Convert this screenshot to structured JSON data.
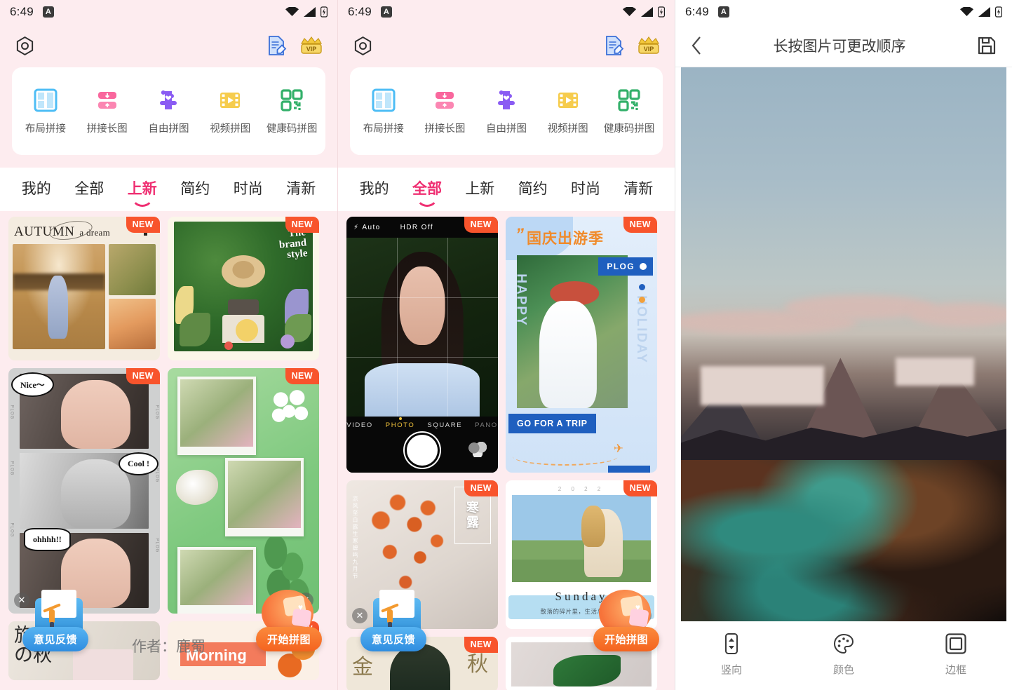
{
  "status_bar": {
    "time": "6:49",
    "app_badge": "A",
    "icons": [
      "wifi-icon",
      "signal-icon",
      "battery-icon"
    ]
  },
  "panel_left": {
    "header": {
      "settings_icon": "settings-hexagon-icon",
      "edit_icon": "document-edit-icon",
      "vip_icon": "vip-crown-icon",
      "vip_label": "VIP"
    },
    "functions": [
      {
        "label": "布局拼接",
        "icon": "layout-collage-icon"
      },
      {
        "label": "拼接长图",
        "icon": "long-image-stitch-icon"
      },
      {
        "label": "自由拼图",
        "icon": "free-collage-icon"
      },
      {
        "label": "视频拼图",
        "icon": "video-collage-icon"
      },
      {
        "label": "健康码拼图",
        "icon": "health-code-collage-icon"
      }
    ],
    "tabs": [
      {
        "label": "我的",
        "active": false
      },
      {
        "label": "全部",
        "active": false
      },
      {
        "label": "上新",
        "active": true
      },
      {
        "label": "简约",
        "active": false
      },
      {
        "label": "时尚",
        "active": false
      },
      {
        "label": "清新",
        "active": false
      }
    ],
    "badge_new": "NEW",
    "cards": {
      "autumn": {
        "title": "AUTUMN",
        "subtitle": "a dream"
      },
      "brand": {
        "line1": "The",
        "line2": "brand",
        "line3": "style"
      },
      "comic": {
        "bubble1": "Nice～",
        "bubble2": "Cool !",
        "bubble3": "ohhhh!!",
        "side_mark": "PLOG"
      },
      "travel": {
        "line1": "旅行",
        "line2": "の秋"
      },
      "morning": {
        "title": "Morning"
      }
    },
    "watermark": "作者：鹿蜀",
    "fab_feedback": "意见反馈",
    "fab_start": "开始拼图"
  },
  "panel_mid": {
    "tabs": [
      {
        "label": "我的",
        "active": false
      },
      {
        "label": "全部",
        "active": true
      },
      {
        "label": "上新",
        "active": false
      },
      {
        "label": "简约",
        "active": false
      },
      {
        "label": "时尚",
        "active": false
      },
      {
        "label": "清新",
        "active": false
      }
    ],
    "cards": {
      "camera": {
        "flash": "Auto",
        "hdr": "HDR Off",
        "modes": [
          "VIDEO",
          "PHOTO",
          "SQUARE",
          "PANO"
        ],
        "active_mode": "PHOTO"
      },
      "trip": {
        "title": "国庆出游季",
        "chip": "PLOG",
        "cta": "GO FOR A TRIP",
        "side_left": "HAPPY",
        "side_right": "HOLIDAY"
      },
      "hanlu": {
        "title1": "寒",
        "title2": "露",
        "side": "凉风至白露生寒蝉鸣九月节"
      },
      "sunday": {
        "year": "2 0 2 2",
        "title": "Sunday",
        "subtitle": "散落的碎片里，生活总会继续"
      },
      "jinqiu": {
        "left": "金",
        "right": "秋"
      }
    }
  },
  "panel_right": {
    "back_icon": "chevron-left-icon",
    "title": "长按图片可更改顺序",
    "save_icon": "save-floppy-icon",
    "images": [
      {
        "name": "mountain-landscape-photo"
      },
      {
        "name": "abstract-fluid-art-photo"
      }
    ],
    "toolbar": [
      {
        "label": "竖向",
        "icon": "vertical-arrows-icon"
      },
      {
        "label": "颜色",
        "icon": "palette-icon"
      },
      {
        "label": "边框",
        "icon": "border-square-icon"
      }
    ]
  },
  "colors": {
    "bg_pink": "#fdecef",
    "accent_pink": "#ef2f72",
    "badge_orange": "#f8542c",
    "blue_pill": "#2f8de0",
    "orange_pill": "#f4631f"
  }
}
